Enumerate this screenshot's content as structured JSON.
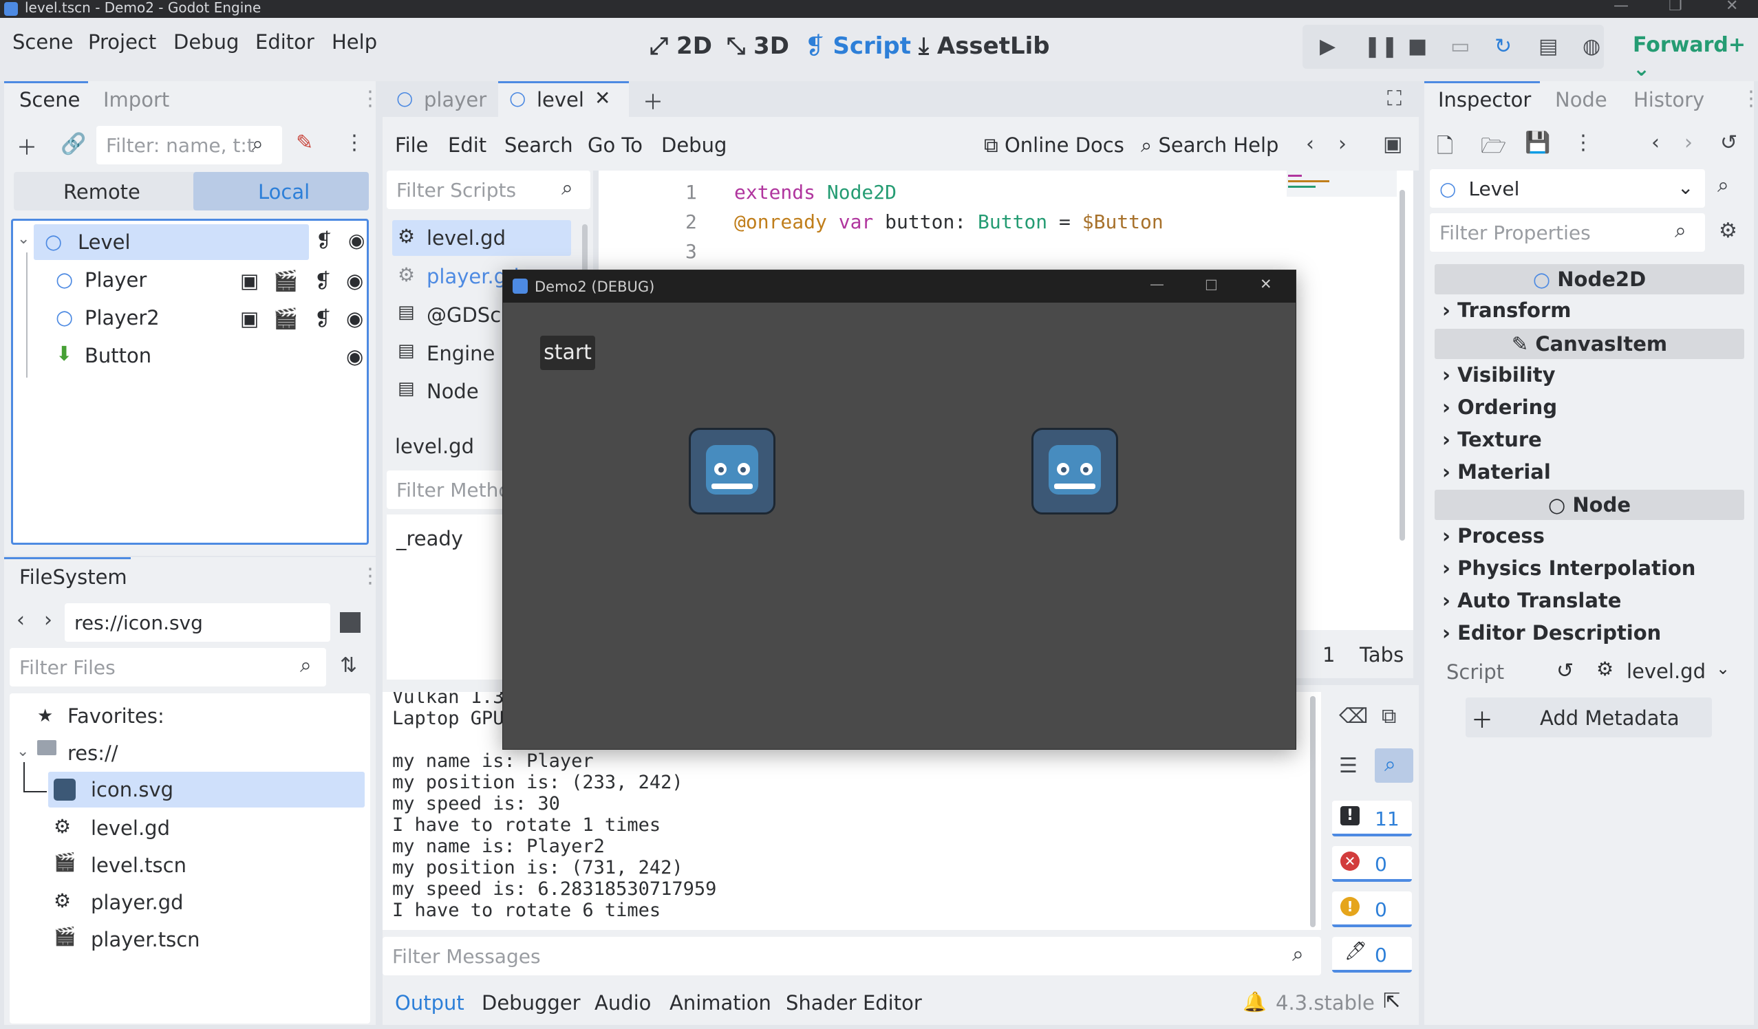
{
  "window": {
    "title": "level.tscn - Demo2 - Godot Engine"
  },
  "menu": {
    "items": [
      "Scene",
      "Project",
      "Debug",
      "Editor",
      "Help"
    ]
  },
  "workspaces": {
    "w2d": "2D",
    "w3d": "3D",
    "script": "Script",
    "assetlib": "AssetLib"
  },
  "renderer": "Forward+",
  "scene_dock": {
    "tabs": {
      "scene": "Scene",
      "import": "Import"
    },
    "filter_placeholder": "Filter: name, t:t",
    "remote": "Remote",
    "local": "Local",
    "nodes": [
      {
        "name": "Level"
      },
      {
        "name": "Player"
      },
      {
        "name": "Player2"
      },
      {
        "name": "Button"
      }
    ]
  },
  "filesystem": {
    "title": "FileSystem",
    "path": "res://icon.svg",
    "filter_placeholder": "Filter Files",
    "favorites": "Favorites:",
    "root": "res://",
    "files": [
      "icon.svg",
      "level.gd",
      "level.tscn",
      "player.gd",
      "player.tscn"
    ]
  },
  "editor_tabs": {
    "player": "player",
    "level": "level"
  },
  "script_menu": {
    "file": "File",
    "edit": "Edit",
    "search": "Search",
    "goto": "Go To",
    "debug": "Debug",
    "online_docs": "Online Docs",
    "search_help": "Search Help"
  },
  "script_list": {
    "filter_placeholder": "Filter Scripts",
    "items": [
      "level.gd",
      "player.gd",
      "@GDScri",
      "Engine",
      "Node"
    ],
    "current": "level.gd",
    "methods_placeholder": "Filter Metho",
    "methods": [
      "_ready"
    ]
  },
  "code": {
    "lines": [
      {
        "n": "1",
        "parts": [
          {
            "t": "extends ",
            "c": "kw"
          },
          {
            "t": "Node2D",
            "c": "ty"
          }
        ]
      },
      {
        "n": "2",
        "parts": [
          {
            "t": "@onready ",
            "c": "ann"
          },
          {
            "t": "var ",
            "c": "kw"
          },
          {
            "t": "button: ",
            "c": ""
          },
          {
            "t": "Button",
            "c": "ty"
          },
          {
            "t": " = ",
            "c": ""
          },
          {
            "t": "$Button",
            "c": "nd"
          }
        ]
      },
      {
        "n": "3",
        "parts": []
      }
    ],
    "status_line": "1",
    "indent": "Tabs"
  },
  "debug_window": {
    "title": "Demo2 (DEBUG)",
    "button": "start"
  },
  "output": {
    "lines": [
      "Vulkan 1.3",
      "Laptop GPU",
      "",
      "my name is: Player",
      "my position is: (233, 242)",
      "my speed is: 30",
      "I have to rotate 1 times",
      "my name is: Player2",
      "my position is: (731, 242)",
      "my speed is: 6.28318530717959",
      "I have to rotate 6 times"
    ],
    "filter_placeholder": "Filter Messages",
    "counts": {
      "messages": "11",
      "errors": "0",
      "warnings": "0",
      "editor": "0"
    }
  },
  "bottom_tabs": [
    "Output",
    "Debugger",
    "Audio",
    "Animation",
    "Shader Editor"
  ],
  "version": "4.3.stable",
  "inspector": {
    "tabs": {
      "inspector": "Inspector",
      "node": "Node",
      "history": "History"
    },
    "object": "Level",
    "filter_placeholder": "Filter Properties",
    "sections": {
      "node2d": "Node2D",
      "canvasitem": "CanvasItem",
      "node": "Node"
    },
    "node2d_props": [
      "Transform"
    ],
    "canvas_props": [
      "Visibility",
      "Ordering",
      "Texture",
      "Material"
    ],
    "node_props": [
      "Process",
      "Physics Interpolation",
      "Auto Translate",
      "Editor Description"
    ],
    "script_label": "Script",
    "script_value": "level.gd",
    "add_metadata": "Add Metadata"
  },
  "colors": {
    "accent": "#4d8ae2",
    "selection": "#cfe0fb",
    "panel": "#eef0f3"
  }
}
